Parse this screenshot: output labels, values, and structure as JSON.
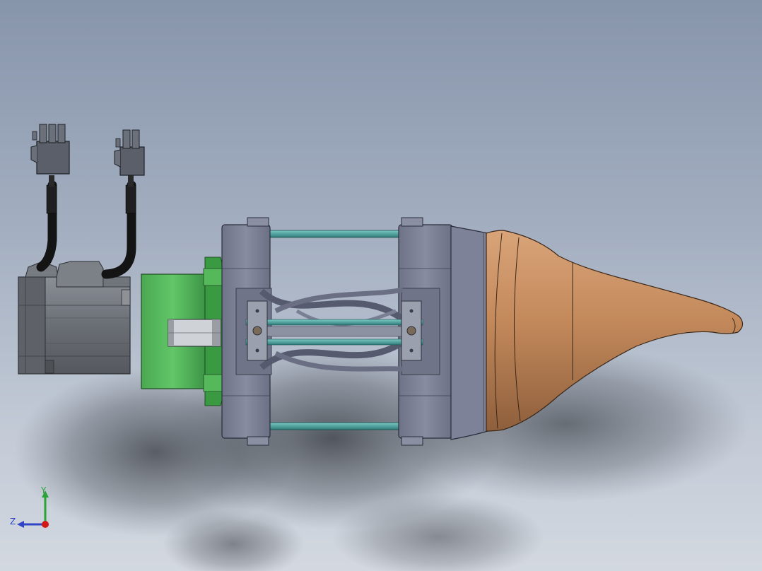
{
  "viewport": {
    "background_top": "#8795ab",
    "background_bottom": "#d3d8e0"
  },
  "model": {
    "colors": {
      "motor_body": "#6f737a",
      "gearbox": "#5cbf62",
      "frame": "#7a7f95",
      "rods": "#4aa3a0",
      "nozzle": "#c2875a",
      "cable": "#161616",
      "connector": "#595e68"
    }
  },
  "triad": {
    "y_label": "Y",
    "z_label": "Z",
    "y_color": "#27a33a",
    "z_color": "#2f45c6",
    "x_color": "#d41818"
  }
}
